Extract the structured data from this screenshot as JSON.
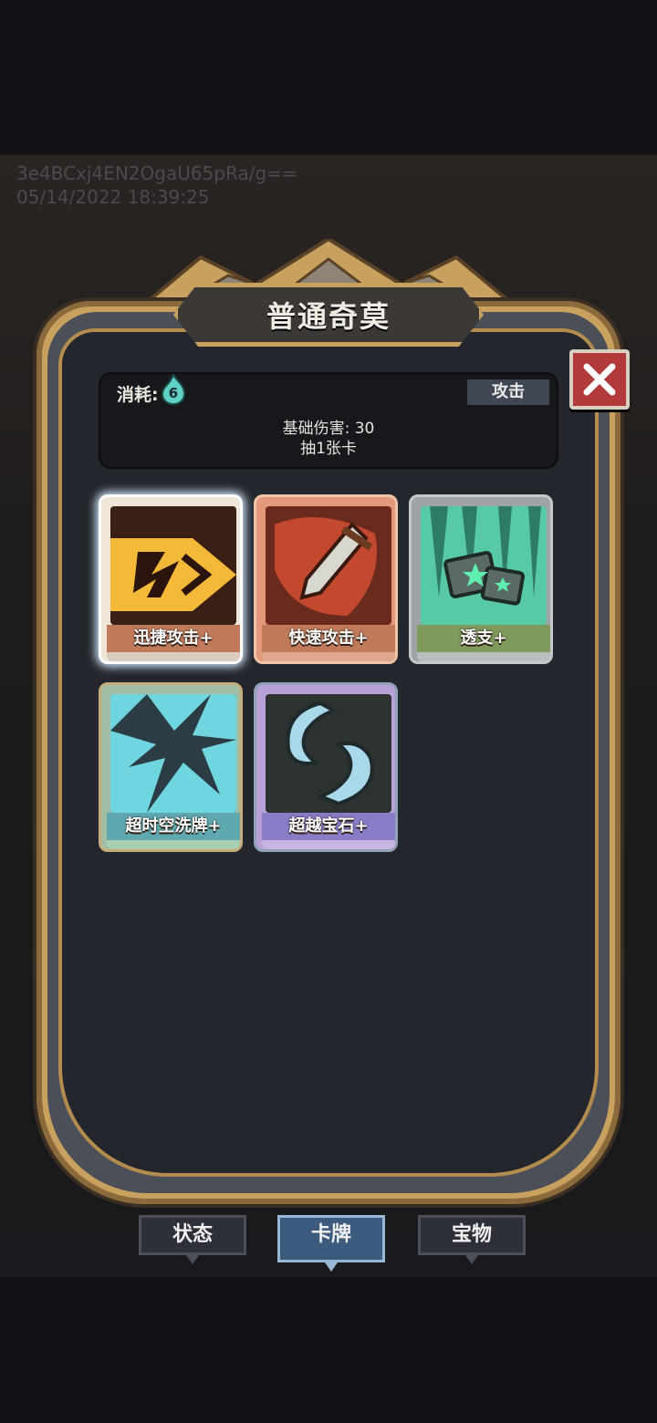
{
  "watermark": {
    "line1": "3e4BCxj4EN2OgaU65pRa/g==",
    "line2": "05/14/2022 18:39:25"
  },
  "dialog": {
    "title": "普通奇莫",
    "close_icon": "close-x-icon"
  },
  "card_detail": {
    "cost_label": "消耗:",
    "cost_value": "6",
    "type": "攻击",
    "description_line1": "基础伤害: 30",
    "description_line2": "抽1张卡"
  },
  "cards": [
    {
      "name": "迅捷攻击+",
      "frame_color": "#d96a3a",
      "bar_color": "#c07a5a",
      "selected": true
    },
    {
      "name": "快速攻击+",
      "frame_color": "#d96a3a",
      "bar_color": "#c07a5a",
      "selected": false
    },
    {
      "name": "透支+",
      "frame_color": "#7e9a5c",
      "bar_color": "#7e9a5c",
      "selected": false
    },
    {
      "name": "超时空洗牌+",
      "frame_color": "#5a9e7a",
      "bar_color": "#5fa8b0",
      "selected": false
    },
    {
      "name": "超越宝石+",
      "frame_color": "#8a6bb8",
      "bar_color": "#8a7bc6",
      "selected": false
    }
  ],
  "tabs": [
    {
      "label": "状态",
      "active": false
    },
    {
      "label": "卡牌",
      "active": true
    },
    {
      "label": "宝物",
      "active": false
    }
  ]
}
